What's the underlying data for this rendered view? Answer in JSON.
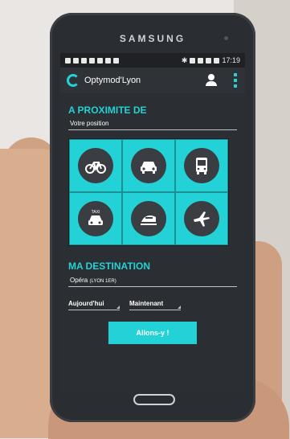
{
  "device": {
    "brand": "SAMSUNG"
  },
  "status_bar": {
    "time": "17:19"
  },
  "app": {
    "title": "Optymod'Lyon"
  },
  "nearby": {
    "title": "A PROXIMITE DE",
    "position_label": "Votre position",
    "modes": [
      {
        "name": "bike-icon"
      },
      {
        "name": "car-icon"
      },
      {
        "name": "bus-icon"
      },
      {
        "name": "taxi-icon",
        "badge": "TAXI"
      },
      {
        "name": "train-icon"
      },
      {
        "name": "plane-icon"
      }
    ]
  },
  "destination": {
    "title": "MA DESTINATION",
    "value_main": "Opéra",
    "value_sub": "(LYON 1ER)"
  },
  "selectors": {
    "day": "Aujourd'hui",
    "time": "Maintenant"
  },
  "action": {
    "go_label": "Allons-y !"
  },
  "colors": {
    "accent": "#23d2d6",
    "dark": "#2b2e32"
  }
}
